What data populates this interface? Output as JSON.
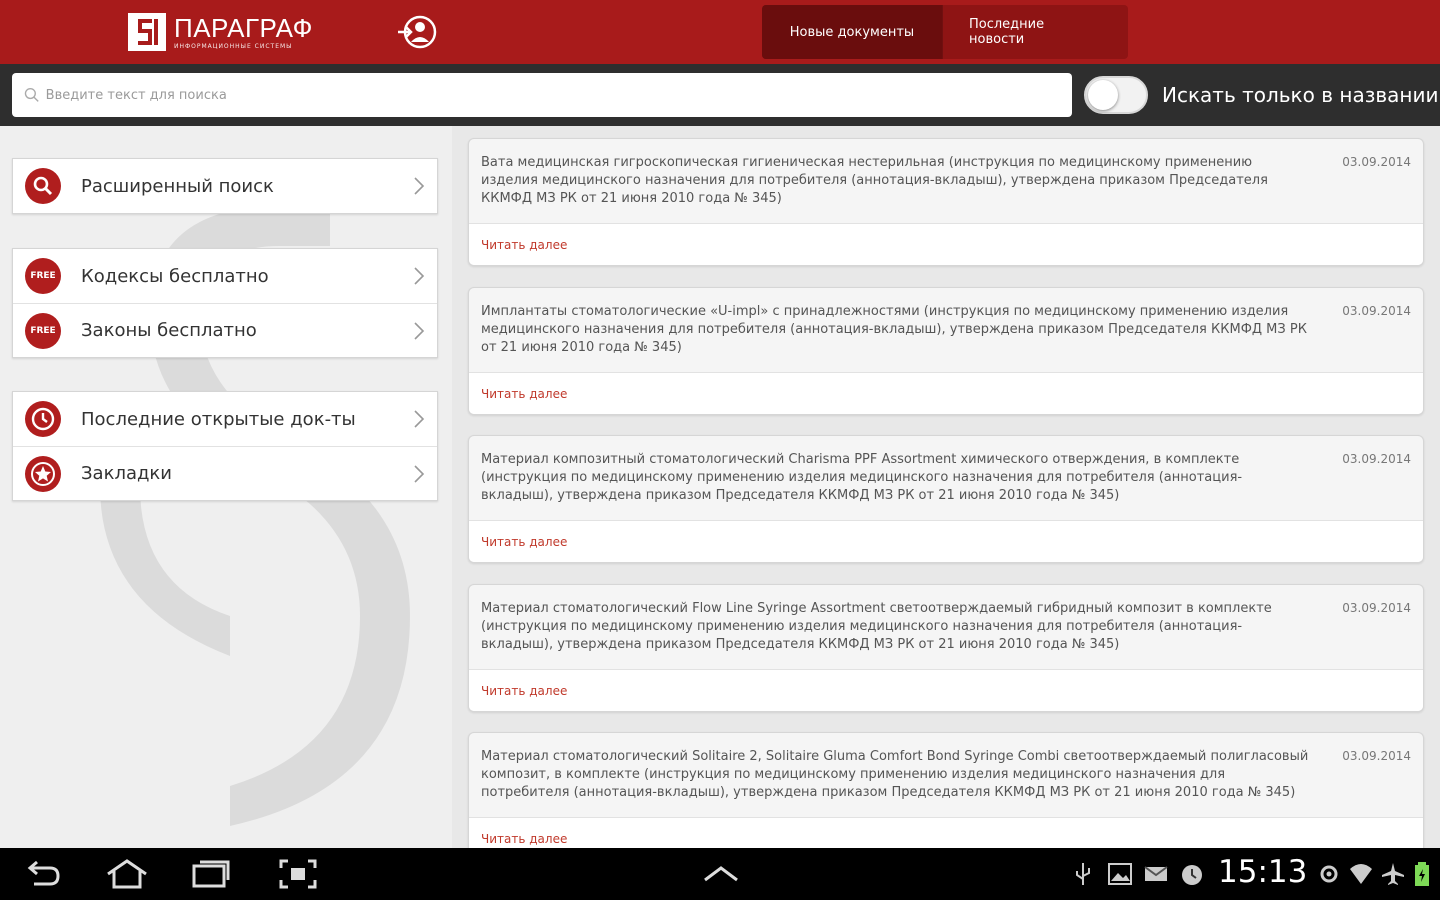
{
  "header": {
    "logo_title": "ПАРАГРАФ",
    "logo_subtitle": "ИНФОРМАЦИОННЫЕ СИСТЕМЫ",
    "tabs": [
      {
        "label": "Новые документы",
        "active": true
      },
      {
        "label": "Последние новости",
        "active": false
      }
    ],
    "brand_color": "#a81b1b"
  },
  "search": {
    "placeholder": "Введите текст для поиска",
    "title_only_label": "Искать только в названии",
    "title_only_enabled": false
  },
  "menu": {
    "groups": [
      [
        {
          "label": "Расширенный поиск",
          "icon": "search-icon"
        }
      ],
      [
        {
          "label": "Кодексы бесплатно",
          "icon": "free-badge-icon",
          "badge": "FREE"
        },
        {
          "label": "Законы бесплатно",
          "icon": "free-badge-icon",
          "badge": "FREE"
        }
      ],
      [
        {
          "label": "Последние открытые док-ты",
          "icon": "clock-icon"
        },
        {
          "label": "Закладки",
          "icon": "star-icon"
        }
      ]
    ]
  },
  "documents": [
    {
      "text": "Вата медицинская гигроскопическая гигиеническая нестерильная (инструкция по медицинскому применению изделия медицинского назначения для потребителя (аннотация-вкладыш), утверждена приказом Председателя ККМФД МЗ РК от 21 июня 2010 года № 345)",
      "date": "03.09.2014",
      "link": "Читать далее"
    },
    {
      "text": "Имплантаты стоматологические «U-impl» с принадлежностями (инструкция по медицинскому применению изделия медицинского назначения для потребителя (аннотация-вкладыш), утверждена приказом Председателя ККМФД МЗ РК от 21 июня 2010 года № 345)",
      "date": "03.09.2014",
      "link": "Читать далее"
    },
    {
      "text": "Материал композитный стоматологический Charisma PPF Assortment химического отверждения, в комплекте (инструкция по медицинскому применению изделия медицинского назначения для потребителя (аннотация-вкладыш), утверждена приказом Председателя ККМФД МЗ РК от 21 июня 2010 года № 345)",
      "date": "03.09.2014",
      "link": "Читать далее"
    },
    {
      "text": "Материал стоматологический Flow Line Syringe Assortment светоотверждаемый гибридный композит в комплекте (инструкция по медицинскому применению изделия медицинского назначения для потребителя (аннотация-вкладыш), утверждена приказом Председателя ККМФД МЗ РК от 21 июня 2010 года № 345)",
      "date": "03.09.2014",
      "link": "Читать далее"
    },
    {
      "text": "Материал стоматологический Solitaire 2, Solitaire Gluma Comfort Bond Syringe Combi светоотверждаемый полигласовый композит, в комплекте (инструкция по медицинскому применению изделия медицинского назначения для потребителя (аннотация-вкладыш), утверждена приказом Председателя ККМФД МЗ РК от 21 июня 2010 года № 345)",
      "date": "03.09.2014",
      "link": "Читать далее"
    }
  ],
  "status_bar": {
    "time": "15:13"
  }
}
